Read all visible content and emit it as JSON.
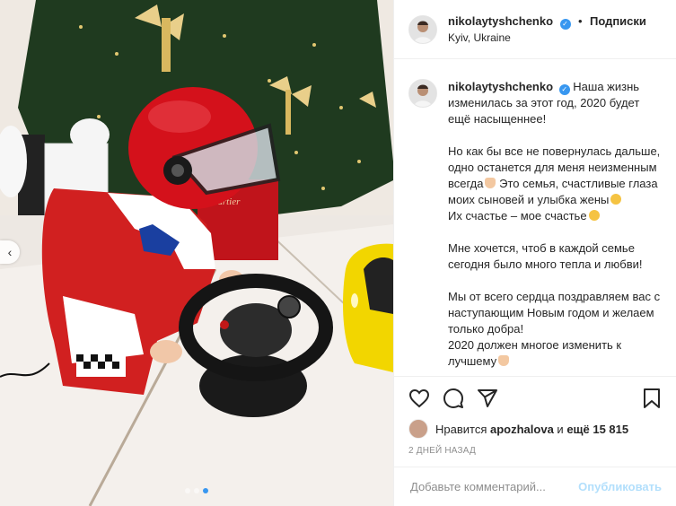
{
  "header": {
    "username": "nikolaytyshchenko",
    "verified": true,
    "separator": "•",
    "follow_label": "Подписки",
    "location": "Kyiv, Ukraine"
  },
  "caption": {
    "username": "nikolaytyshchenko",
    "line1": "Наша жизнь изменилась за этот год, 2020 будет ещё насыщеннее!",
    "para2a": "Но как бы все не повернулась дальше, одно останется для меня неизменным всегда",
    "para2b": "Это семья, счастливые глаза моих сыновей и улыбка жены",
    "para2c": "Их счастье – мое счастье",
    "para3": "Мне хочется, чтоб в каждой семье сегодня было много тепла и любви!",
    "para4a": "Мы от всего сердца поздравляем вас с наступающим Новым годом и желаем только добра!",
    "para4b": "2020 должен многое изменить к лучшему"
  },
  "likes": {
    "prefix": "Нравится",
    "user": "apozhalova",
    "middle": "и",
    "count": "ещё 15 815"
  },
  "timestamp": "2 ДНЕЙ НАЗАД",
  "comment": {
    "placeholder": "Добавьте комментарий...",
    "publish_label": "Опубликовать"
  },
  "carousel": {
    "total": 3,
    "active_index": 2
  },
  "photo_text": {
    "bag_brand": "Cartier"
  },
  "colors": {
    "accent": "#3897f0",
    "helmet": "#d4111b",
    "car": "#f2d600"
  },
  "icons": [
    "verified-icon",
    "heart-icon",
    "comment-icon",
    "share-icon",
    "bookmark-icon",
    "chevron-left-icon"
  ]
}
